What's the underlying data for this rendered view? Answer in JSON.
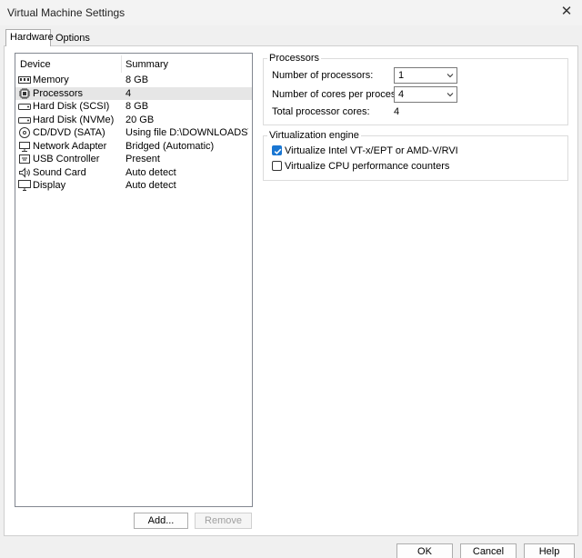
{
  "window": {
    "title": "Virtual Machine Settings",
    "close_icon": "close-icon"
  },
  "tabs": [
    {
      "label": "Hardware",
      "active": true
    },
    {
      "label": "Options",
      "active": false
    }
  ],
  "device_list": {
    "columns": {
      "device": "Device",
      "summary": "Summary"
    },
    "rows": [
      {
        "icon": "memory-icon",
        "device": "Memory",
        "summary": "8 GB"
      },
      {
        "icon": "processor-icon",
        "device": "Processors",
        "summary": "4",
        "selected": true
      },
      {
        "icon": "hard-disk-icon",
        "device": "Hard Disk (SCSI)",
        "summary": "8 GB"
      },
      {
        "icon": "hard-disk-icon",
        "device": "Hard Disk (NVMe)",
        "summary": "20 GB"
      },
      {
        "icon": "cd-dvd-icon",
        "device": "CD/DVD (SATA)",
        "summary": "Using file D:\\DOWNLOADS\\IS..."
      },
      {
        "icon": "network-adapter-icon",
        "device": "Network Adapter",
        "summary": "Bridged (Automatic)"
      },
      {
        "icon": "usb-icon",
        "device": "USB Controller",
        "summary": "Present"
      },
      {
        "icon": "sound-card-icon",
        "device": "Sound Card",
        "summary": "Auto detect"
      },
      {
        "icon": "display-icon",
        "device": "Display",
        "summary": "Auto detect"
      }
    ],
    "add_label": "Add...",
    "remove_label": "Remove"
  },
  "processors": {
    "group_title": "Processors",
    "num_processors_label": "Number of processors:",
    "num_processors_value": "1",
    "cores_label": "Number of cores per processor:",
    "cores_value": "4",
    "total_label": "Total processor cores:",
    "total_value": "4"
  },
  "virtualization": {
    "group_title": "Virtualization engine",
    "vtx_label": "Virtualize Intel VT-x/EPT or AMD-V/RVI",
    "vtx_checked": true,
    "perf_label": "Virtualize CPU performance counters",
    "perf_checked": false
  },
  "footer": {
    "ok": "OK",
    "cancel": "Cancel",
    "help": "Help"
  },
  "colors": {
    "accent": "#1976d2",
    "selection": "#e6e6e6"
  }
}
